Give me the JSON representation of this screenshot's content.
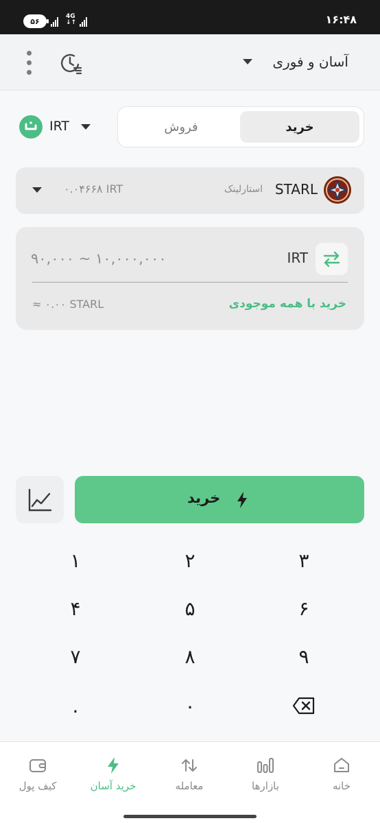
{
  "status_bar": {
    "time": "۱۶:۴۸",
    "battery": "۵۶",
    "network": "4G"
  },
  "header": {
    "title": "آسان و فوری"
  },
  "trade_tabs": {
    "buy_label": "خرید",
    "sell_label": "فروش"
  },
  "currency_selector": {
    "code": "IRT"
  },
  "asset": {
    "symbol": "STARL",
    "name": "استارلینک",
    "price": "۰.۰۴۶۶۸",
    "price_unit": "IRT"
  },
  "amount": {
    "unit": "IRT",
    "placeholder": "۹۰,۰۰۰ ~ ۱۰,۰۰۰,۰۰۰",
    "buy_all_label": "خرید با همه موجودی",
    "estimate": "≈ ۰.۰۰ STARL"
  },
  "action": {
    "buy_label": "خرید"
  },
  "keypad": [
    "۱",
    "۲",
    "۳",
    "۴",
    "۵",
    "۶",
    "۷",
    "۸",
    "۹",
    ".",
    "۰"
  ],
  "bottom_nav": [
    {
      "label": "خانه",
      "icon": "home-icon"
    },
    {
      "label": "بازارها",
      "icon": "markets-icon"
    },
    {
      "label": "معامله",
      "icon": "trade-icon"
    },
    {
      "label": "خرید آسان",
      "icon": "lightning-icon",
      "active": true
    },
    {
      "label": "کیف پول",
      "icon": "wallet-icon"
    }
  ],
  "colors": {
    "accent": "#5ec88a",
    "accent_text": "#4cbd84",
    "status_bar": "#1a1a1a"
  }
}
